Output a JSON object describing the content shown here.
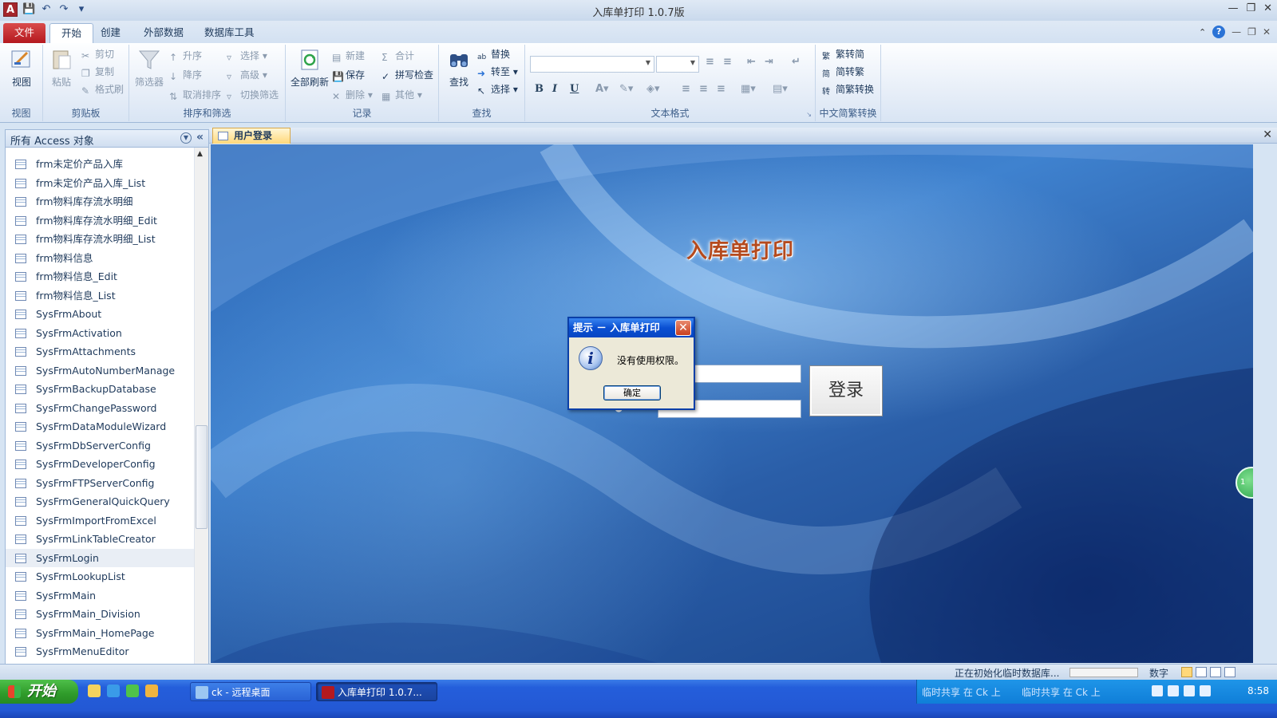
{
  "window": {
    "title": "入库单打印 1.0.7版",
    "app_icon": "A"
  },
  "ribbon_tabs": {
    "file": "文件",
    "home": "开始",
    "create": "创建",
    "external": "外部数据",
    "dbtools": "数据库工具"
  },
  "ribbon": {
    "view": {
      "view_label": "视图",
      "group_label": "视图"
    },
    "clipboard": {
      "paste": "粘贴",
      "cut": "剪切",
      "copy": "复制",
      "format_painter": "格式刷",
      "group_label": "剪贴板"
    },
    "sort_filter": {
      "filter": "筛选器",
      "ascending": "升序",
      "descending": "降序",
      "clear_sort": "取消排序",
      "selection": "选择",
      "advanced": "高级",
      "toggle_filter": "切换筛选",
      "group_label": "排序和筛选"
    },
    "records": {
      "refresh_all": "全部刷新",
      "new": "新建",
      "save": "保存",
      "delete": "删除",
      "totals": "合计",
      "spelling": "拼写检查",
      "more": "其他",
      "group_label": "记录"
    },
    "find": {
      "find": "查找",
      "replace": "替换",
      "goto": "转至",
      "select": "选择",
      "group_label": "查找"
    },
    "text_format": {
      "bold": "B",
      "italic": "I",
      "underline": "U",
      "group_label": "文本格式"
    },
    "chinese_conversion": {
      "trad_to_simp": "繁转简",
      "simp_to_trad": "简转繁",
      "conversion": "简繁转换",
      "group_label": "中文简繁转换"
    }
  },
  "nav_pane": {
    "title": "所有 Access 对象",
    "items": [
      "frm未定价产品入库",
      "frm未定价产品入库_List",
      "frm物料库存流水明细",
      "frm物料库存流水明细_Edit",
      "frm物料库存流水明细_List",
      "frm物料信息",
      "frm物料信息_Edit",
      "frm物料信息_List",
      "SysFrmAbout",
      "SysFrmActivation",
      "SysFrmAttachments",
      "SysFrmAutoNumberManage",
      "SysFrmBackupDatabase",
      "SysFrmChangePassword",
      "SysFrmDataModuleWizard",
      "SysFrmDbServerConfig",
      "SysFrmDeveloperConfig",
      "SysFrmFTPServerConfig",
      "SysFrmGeneralQuickQuery",
      "SysFrmImportFromExcel",
      "SysFrmLinkTableCreator",
      "SysFrmLogin",
      "SysFrmLookupList",
      "SysFrmMain",
      "SysFrmMain_Division",
      "SysFrmMain_HomePage",
      "SysFrmMenuEditor"
    ],
    "selected_item": "SysFrmLogin"
  },
  "document": {
    "tab_label": "用户登录",
    "form_title": "入库单打印",
    "login_button": "登录"
  },
  "message_box": {
    "title": "提示 － 入库单打印",
    "message": "没有使用权限。",
    "ok_button": "确定"
  },
  "status_bar": {
    "status_text": "正在初始化临时数据库...",
    "num_lock": "数字"
  },
  "taskbar": {
    "start": "开始",
    "tasks": [
      "ck - 远程桌面",
      "入库单打印 1.0.7..."
    ],
    "tray_share_1": "临时共享 在 Ck 上",
    "tray_share_2": "临时共享 在 Ck 上",
    "clock": "8:58"
  },
  "colors": {
    "file_tab": "#b4191f",
    "doc_tab": "#ffd87a",
    "dialog_title": "#0a4fd2",
    "form_title": "#b54a1e",
    "taskbar": "#245edb",
    "start_button": "#2f9b2a"
  }
}
